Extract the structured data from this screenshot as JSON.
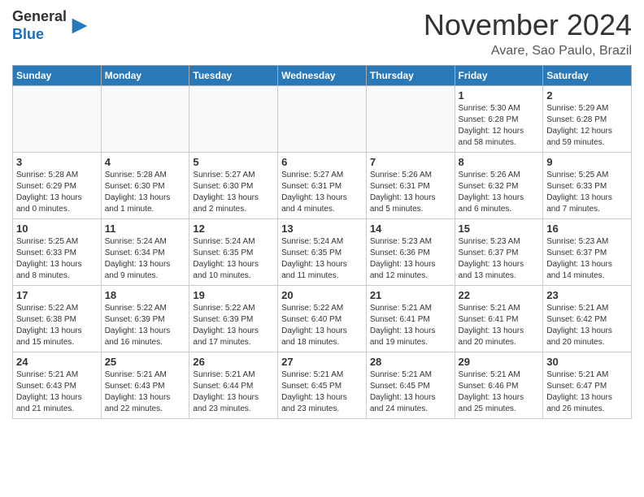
{
  "header": {
    "logo_general": "General",
    "logo_blue": "Blue",
    "month_title": "November 2024",
    "location": "Avare, Sao Paulo, Brazil"
  },
  "weekdays": [
    "Sunday",
    "Monday",
    "Tuesday",
    "Wednesday",
    "Thursday",
    "Friday",
    "Saturday"
  ],
  "weeks": [
    [
      {
        "day": "",
        "info": ""
      },
      {
        "day": "",
        "info": ""
      },
      {
        "day": "",
        "info": ""
      },
      {
        "day": "",
        "info": ""
      },
      {
        "day": "",
        "info": ""
      },
      {
        "day": "1",
        "info": "Sunrise: 5:30 AM\nSunset: 6:28 PM\nDaylight: 12 hours and 58 minutes."
      },
      {
        "day": "2",
        "info": "Sunrise: 5:29 AM\nSunset: 6:28 PM\nDaylight: 12 hours and 59 minutes."
      }
    ],
    [
      {
        "day": "3",
        "info": "Sunrise: 5:28 AM\nSunset: 6:29 PM\nDaylight: 13 hours and 0 minutes."
      },
      {
        "day": "4",
        "info": "Sunrise: 5:28 AM\nSunset: 6:30 PM\nDaylight: 13 hours and 1 minute."
      },
      {
        "day": "5",
        "info": "Sunrise: 5:27 AM\nSunset: 6:30 PM\nDaylight: 13 hours and 2 minutes."
      },
      {
        "day": "6",
        "info": "Sunrise: 5:27 AM\nSunset: 6:31 PM\nDaylight: 13 hours and 4 minutes."
      },
      {
        "day": "7",
        "info": "Sunrise: 5:26 AM\nSunset: 6:31 PM\nDaylight: 13 hours and 5 minutes."
      },
      {
        "day": "8",
        "info": "Sunrise: 5:26 AM\nSunset: 6:32 PM\nDaylight: 13 hours and 6 minutes."
      },
      {
        "day": "9",
        "info": "Sunrise: 5:25 AM\nSunset: 6:33 PM\nDaylight: 13 hours and 7 minutes."
      }
    ],
    [
      {
        "day": "10",
        "info": "Sunrise: 5:25 AM\nSunset: 6:33 PM\nDaylight: 13 hours and 8 minutes."
      },
      {
        "day": "11",
        "info": "Sunrise: 5:24 AM\nSunset: 6:34 PM\nDaylight: 13 hours and 9 minutes."
      },
      {
        "day": "12",
        "info": "Sunrise: 5:24 AM\nSunset: 6:35 PM\nDaylight: 13 hours and 10 minutes."
      },
      {
        "day": "13",
        "info": "Sunrise: 5:24 AM\nSunset: 6:35 PM\nDaylight: 13 hours and 11 minutes."
      },
      {
        "day": "14",
        "info": "Sunrise: 5:23 AM\nSunset: 6:36 PM\nDaylight: 13 hours and 12 minutes."
      },
      {
        "day": "15",
        "info": "Sunrise: 5:23 AM\nSunset: 6:37 PM\nDaylight: 13 hours and 13 minutes."
      },
      {
        "day": "16",
        "info": "Sunrise: 5:23 AM\nSunset: 6:37 PM\nDaylight: 13 hours and 14 minutes."
      }
    ],
    [
      {
        "day": "17",
        "info": "Sunrise: 5:22 AM\nSunset: 6:38 PM\nDaylight: 13 hours and 15 minutes."
      },
      {
        "day": "18",
        "info": "Sunrise: 5:22 AM\nSunset: 6:39 PM\nDaylight: 13 hours and 16 minutes."
      },
      {
        "day": "19",
        "info": "Sunrise: 5:22 AM\nSunset: 6:39 PM\nDaylight: 13 hours and 17 minutes."
      },
      {
        "day": "20",
        "info": "Sunrise: 5:22 AM\nSunset: 6:40 PM\nDaylight: 13 hours and 18 minutes."
      },
      {
        "day": "21",
        "info": "Sunrise: 5:21 AM\nSunset: 6:41 PM\nDaylight: 13 hours and 19 minutes."
      },
      {
        "day": "22",
        "info": "Sunrise: 5:21 AM\nSunset: 6:41 PM\nDaylight: 13 hours and 20 minutes."
      },
      {
        "day": "23",
        "info": "Sunrise: 5:21 AM\nSunset: 6:42 PM\nDaylight: 13 hours and 20 minutes."
      }
    ],
    [
      {
        "day": "24",
        "info": "Sunrise: 5:21 AM\nSunset: 6:43 PM\nDaylight: 13 hours and 21 minutes."
      },
      {
        "day": "25",
        "info": "Sunrise: 5:21 AM\nSunset: 6:43 PM\nDaylight: 13 hours and 22 minutes."
      },
      {
        "day": "26",
        "info": "Sunrise: 5:21 AM\nSunset: 6:44 PM\nDaylight: 13 hours and 23 minutes."
      },
      {
        "day": "27",
        "info": "Sunrise: 5:21 AM\nSunset: 6:45 PM\nDaylight: 13 hours and 23 minutes."
      },
      {
        "day": "28",
        "info": "Sunrise: 5:21 AM\nSunset: 6:45 PM\nDaylight: 13 hours and 24 minutes."
      },
      {
        "day": "29",
        "info": "Sunrise: 5:21 AM\nSunset: 6:46 PM\nDaylight: 13 hours and 25 minutes."
      },
      {
        "day": "30",
        "info": "Sunrise: 5:21 AM\nSunset: 6:47 PM\nDaylight: 13 hours and 26 minutes."
      }
    ]
  ]
}
